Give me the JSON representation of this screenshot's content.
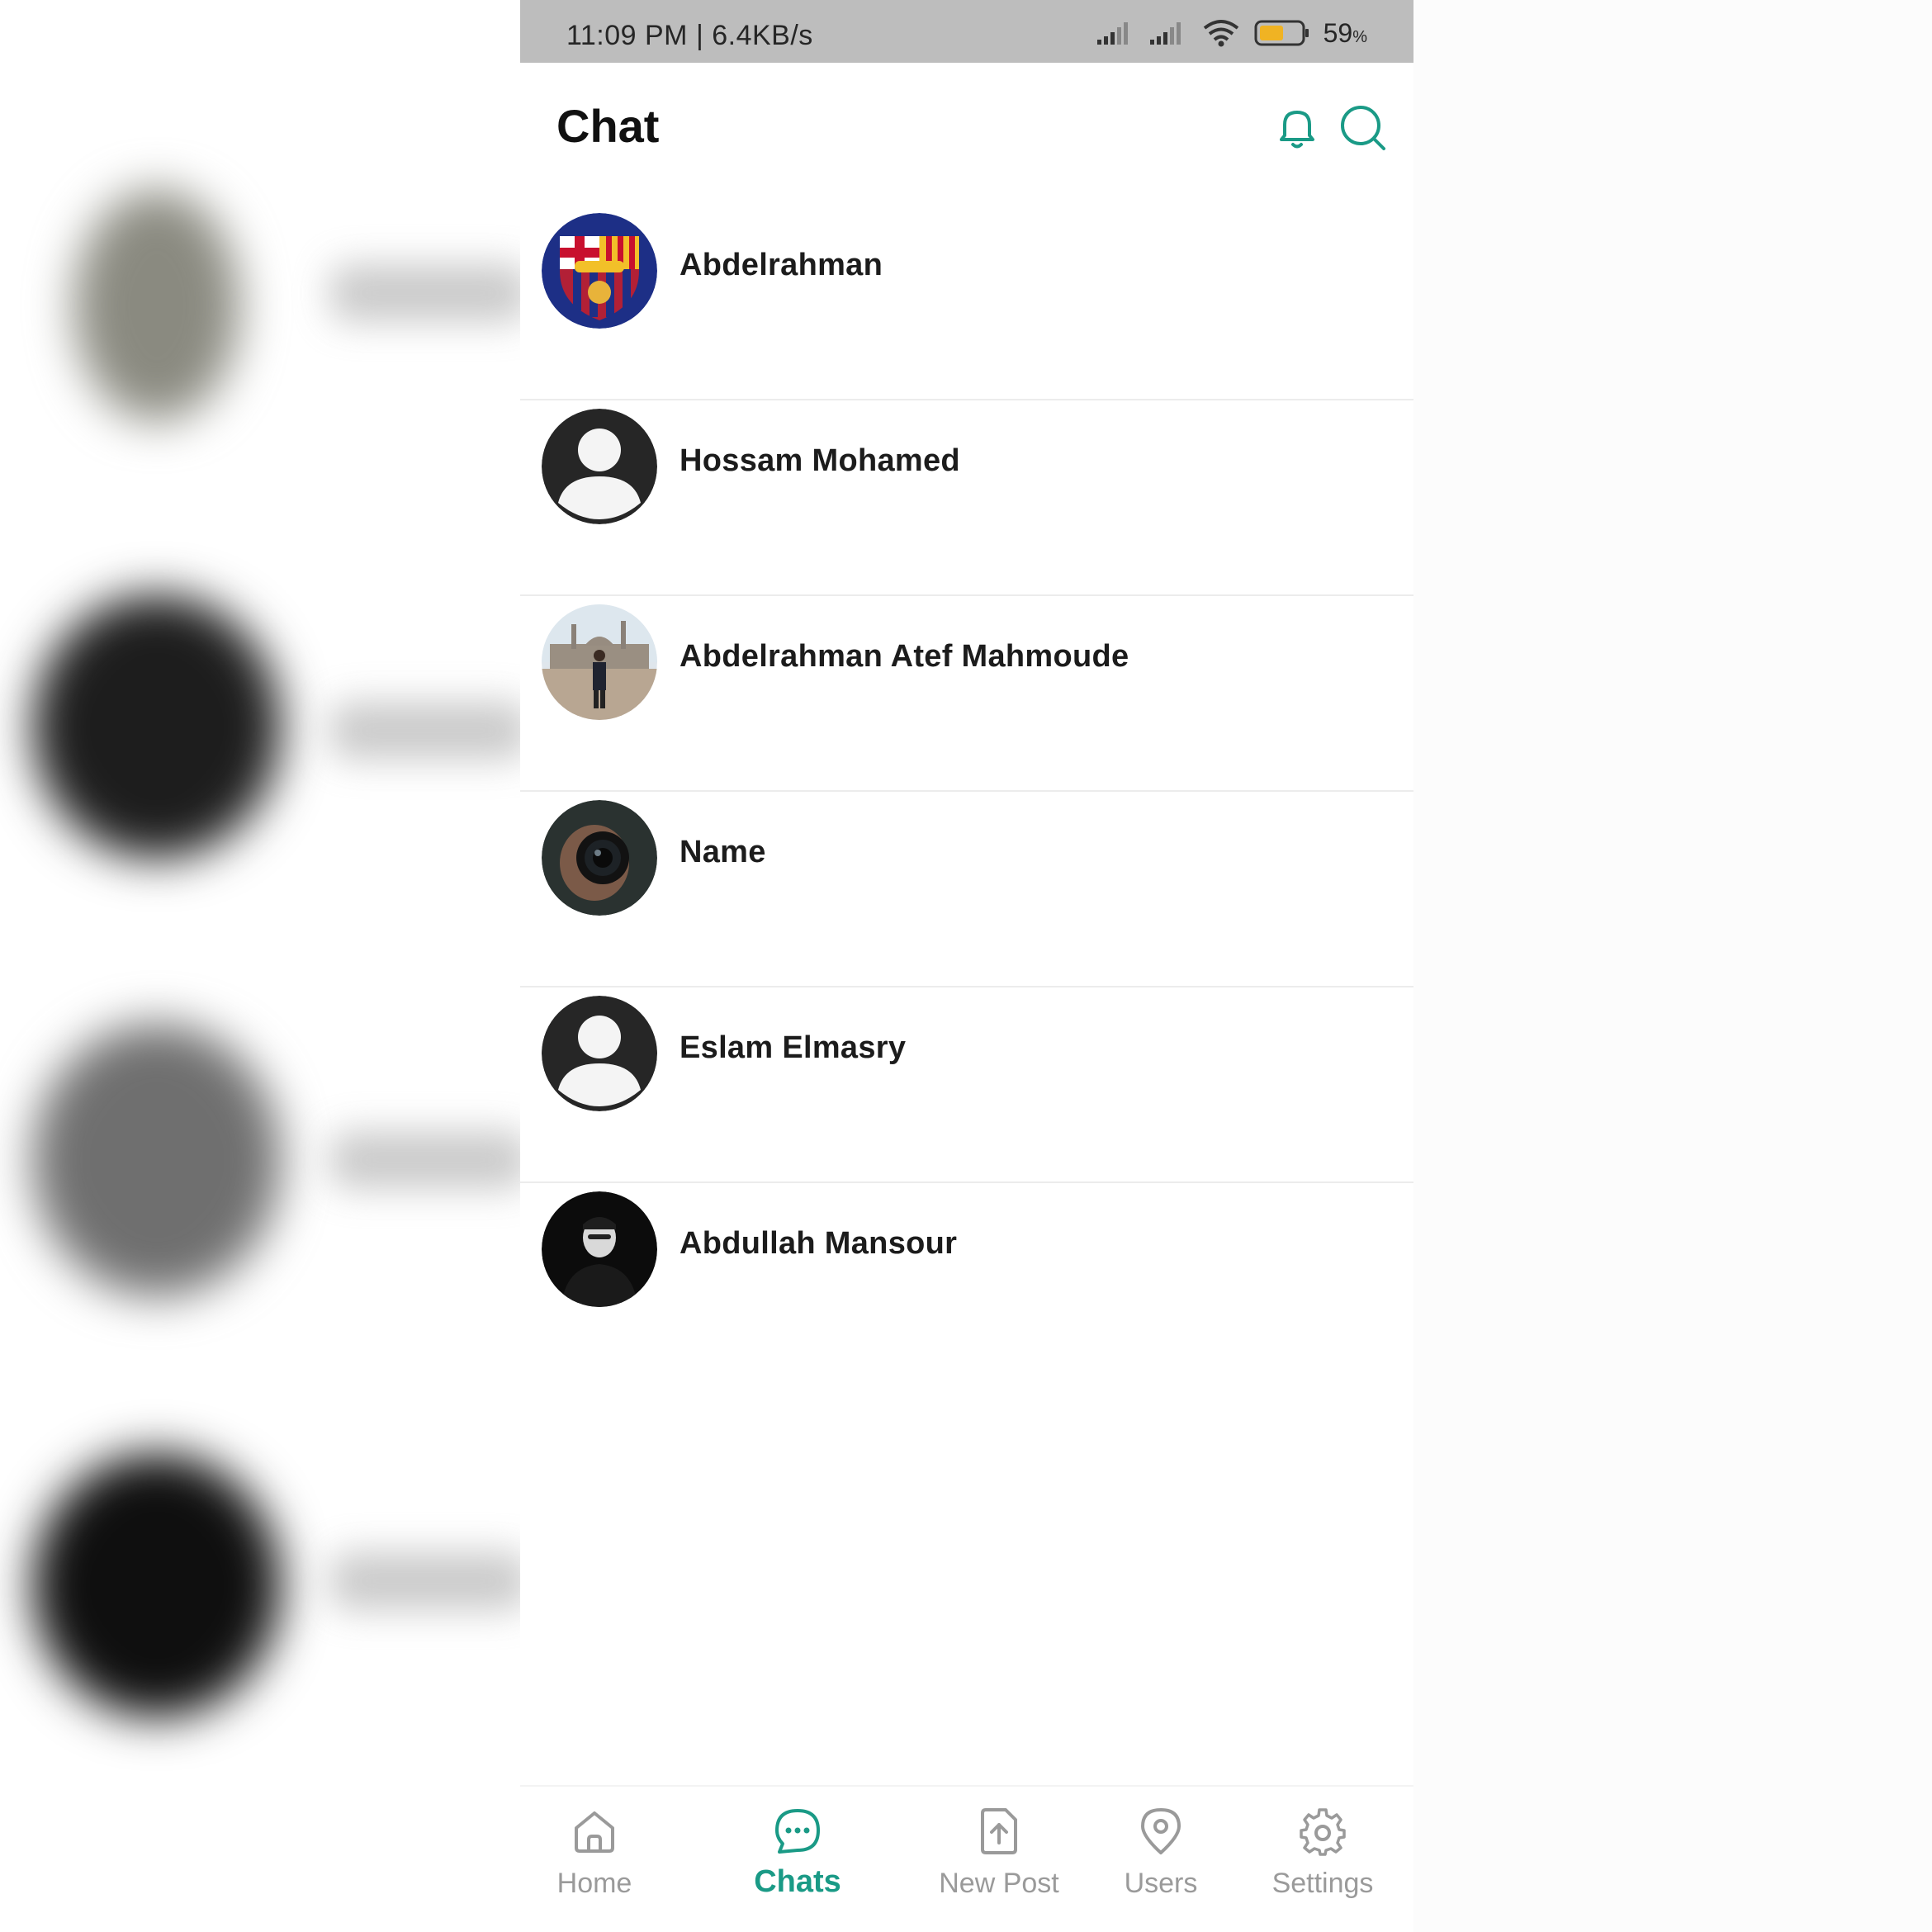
{
  "status_bar": {
    "time_speed": "11:09 PM | 6.4KB/s",
    "battery_percent": "59",
    "battery_unit": "%",
    "battery_level": 0.59,
    "icons": [
      "signal-icon",
      "signal-icon",
      "wifi-icon",
      "battery-icon"
    ]
  },
  "header": {
    "title": "Chat",
    "icons": [
      "bell-icon",
      "search-icon"
    ]
  },
  "chats": [
    {
      "name": "Abdelrahman",
      "avatar": "club-crest-avatar"
    },
    {
      "name": "Hossam Mohamed",
      "avatar": "default-user-avatar"
    },
    {
      "name": "Abdelrahman Atef Mahmoude",
      "avatar": "photo-avatar"
    },
    {
      "name": "Name",
      "avatar": "camera-lens-avatar"
    },
    {
      "name": "Eslam Elmasry",
      "avatar": "default-user-avatar"
    },
    {
      "name": "Abdullah Mansour",
      "avatar": "photo-avatar"
    }
  ],
  "bottom_nav": {
    "items": [
      {
        "label": "Home",
        "icon": "home-icon",
        "active": false
      },
      {
        "label": "Chats",
        "icon": "chat-bubble-icon",
        "active": true
      },
      {
        "label": "New Post",
        "icon": "upload-file-icon",
        "active": false
      },
      {
        "label": "Users",
        "icon": "location-pin-icon",
        "active": false
      },
      {
        "label": "Settings",
        "icon": "gear-icon",
        "active": false
      }
    ]
  },
  "colors": {
    "accent": "#1a9a86",
    "status_bar": "#bdbdbd",
    "inactive": "#9a9a9a",
    "battery_fill": "#f0b323"
  }
}
